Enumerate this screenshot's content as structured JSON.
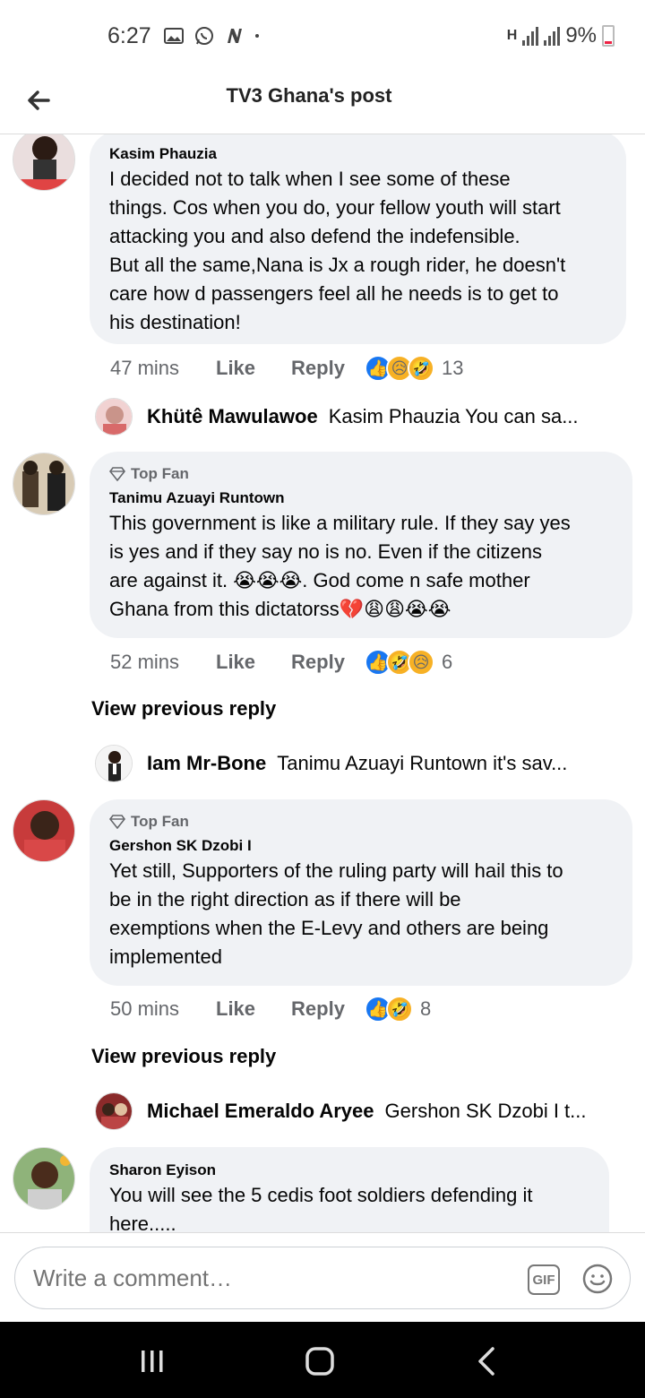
{
  "status_bar": {
    "time": "6:27",
    "battery": "9%",
    "network_symbol": "H"
  },
  "header": {
    "title": "TV3 Ghana's post"
  },
  "comments": [
    {
      "author": "Kasim Phauzia",
      "top_fan": false,
      "lines": [
        "I decided not to talk when I see some of these",
        "things. Cos when you do, your fellow youth will start",
        "attacking you and also defend the indefensible.",
        "But all the same,Nana is Jx a rough rider, he doesn't",
        "care how d passengers feel all he needs is to get to",
        "his destination!"
      ],
      "time": "47 mins",
      "like": "Like",
      "reply": "Reply",
      "reactions": [
        "👍",
        "😥",
        "🤣"
      ],
      "count": "13"
    },
    {
      "author": "Tanimu Azuayi Runtown",
      "top_fan": true,
      "badge": "Top Fan",
      "lines": [
        "This government is like a military rule. If they say yes",
        "is yes and if they say no is no. Even if the citizens",
        "are against it. 😭😭😭. God come n safe mother",
        "Ghana from this dictatorss💔😩😩😭😭"
      ],
      "time": "52 mins",
      "like": "Like",
      "reply": "Reply",
      "reactions": [
        "👍",
        "🤣",
        "😥"
      ],
      "count": "6"
    },
    {
      "author": "Gershon SK Dzobi I",
      "top_fan": true,
      "badge": "Top Fan",
      "lines": [
        "Yet still, Supporters of the ruling party will hail this to",
        "be in the right direction as if there will be",
        "exemptions when the E-Levy and others are being",
        "implemented"
      ],
      "time": "50 mins",
      "like": "Like",
      "reply": "Reply",
      "reactions": [
        "👍",
        "🤣"
      ],
      "count": "8"
    },
    {
      "author": "Sharon Eyison",
      "top_fan": false,
      "lines": [
        "You will see the 5 cedis foot soldiers defending it",
        "here....."
      ]
    }
  ],
  "replies": [
    {
      "name": "Khütê Mawulawoe",
      "text": "Kasim Phauzia You can sa..."
    },
    {
      "name": "Iam Mr-Bone",
      "text": "Tanimu Azuayi Runtown it's sav..."
    },
    {
      "name": "Michael Emeraldo Aryee",
      "text": "Gershon SK Dzobi I t..."
    }
  ],
  "view_previous_reply": "View previous reply",
  "composer": {
    "placeholder": "Write a comment…",
    "gif_label": "GIF"
  },
  "colors": {
    "bubble": "#f0f2f5",
    "like_blue": "#1877f2",
    "muted": "#65676b"
  }
}
